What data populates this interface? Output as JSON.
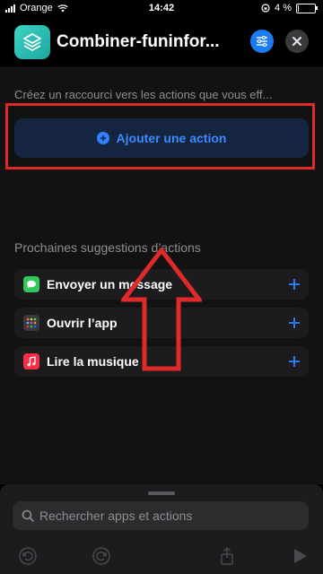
{
  "status_bar": {
    "carrier": "Orange",
    "time": "14:42",
    "battery_text": "4 %",
    "battery_level": 0.04
  },
  "header": {
    "title": "Combiner-funinfor...",
    "accent_color": "#1a7cf5",
    "app_icon_color": "#2cc2b6"
  },
  "main": {
    "hint": "Créez un raccourci vers les actions que vous eff...",
    "add_action_label": "Ajouter une action",
    "suggestions_title": "Prochaines suggestions d’actions",
    "suggestions": [
      {
        "label": "Envoyer un message",
        "icon": "messages-icon",
        "color": "#34c759"
      },
      {
        "label": "Ouvrir l’app",
        "icon": "apps-grid-icon",
        "color": "#3a3a3c"
      },
      {
        "label": "Lire la musique",
        "icon": "music-icon",
        "color": "#fa2d48"
      }
    ],
    "annotation_color": "#e02a2a"
  },
  "bottom_sheet": {
    "search_placeholder": "Rechercher apps et actions",
    "toolbar": [
      "undo-icon",
      "redo-icon",
      "share-icon",
      "play-icon"
    ]
  }
}
